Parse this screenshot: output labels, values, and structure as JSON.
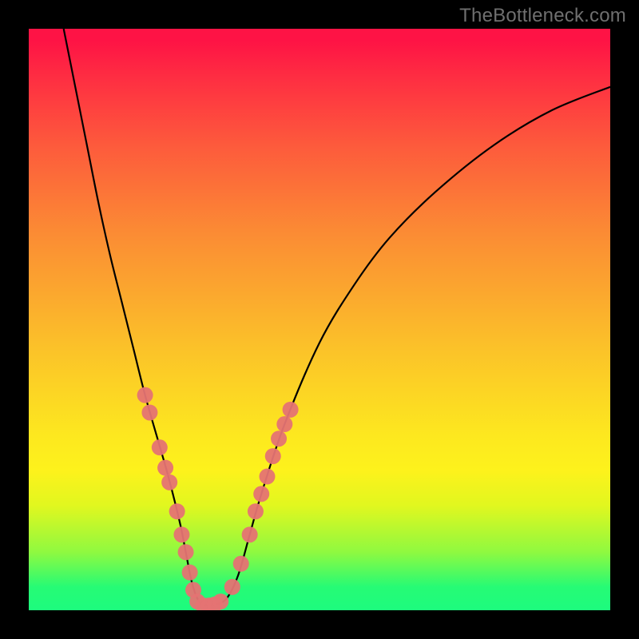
{
  "attribution": "TheBottleneck.com",
  "chart_data": {
    "type": "line",
    "title": "",
    "xlabel": "",
    "ylabel": "",
    "xlim": [
      0,
      100
    ],
    "ylim": [
      0,
      100
    ],
    "series": [
      {
        "name": "bottleneck-curve",
        "x": [
          6,
          8,
          10,
          12,
          14,
          16,
          18,
          20,
          22,
          24,
          26,
          27,
          28,
          29,
          30,
          32,
          34,
          36,
          38,
          40,
          44,
          50,
          56,
          62,
          70,
          80,
          90,
          100
        ],
        "y": [
          100,
          90,
          80,
          70,
          61,
          53,
          45,
          37,
          30,
          23,
          15,
          10,
          5,
          2,
          1,
          1,
          2,
          6,
          13,
          20,
          32,
          46,
          56,
          64,
          72,
          80,
          86,
          90
        ]
      }
    ],
    "markers": {
      "name": "highlighted-points",
      "points": [
        {
          "x": 20.0,
          "y": 37
        },
        {
          "x": 20.8,
          "y": 34
        },
        {
          "x": 22.5,
          "y": 28
        },
        {
          "x": 23.5,
          "y": 24.5
        },
        {
          "x": 24.2,
          "y": 22
        },
        {
          "x": 25.5,
          "y": 17
        },
        {
          "x": 26.3,
          "y": 13
        },
        {
          "x": 27.0,
          "y": 10
        },
        {
          "x": 27.7,
          "y": 6.5
        },
        {
          "x": 28.3,
          "y": 3.5
        },
        {
          "x": 29.0,
          "y": 1.5
        },
        {
          "x": 30.0,
          "y": 0.8
        },
        {
          "x": 31.0,
          "y": 0.8
        },
        {
          "x": 32.0,
          "y": 1.0
        },
        {
          "x": 33.0,
          "y": 1.5
        },
        {
          "x": 35.0,
          "y": 4
        },
        {
          "x": 36.5,
          "y": 8
        },
        {
          "x": 38.0,
          "y": 13
        },
        {
          "x": 39.0,
          "y": 17
        },
        {
          "x": 40.0,
          "y": 20
        },
        {
          "x": 41.0,
          "y": 23
        },
        {
          "x": 42.0,
          "y": 26.5
        },
        {
          "x": 43.0,
          "y": 29.5
        },
        {
          "x": 44.0,
          "y": 32
        },
        {
          "x": 45.0,
          "y": 34.5
        }
      ]
    },
    "colors": {
      "curve": "#000000",
      "marker": "#e57373",
      "gradient_top": "#fe1345",
      "gradient_bottom": "#1dfb7e"
    }
  }
}
